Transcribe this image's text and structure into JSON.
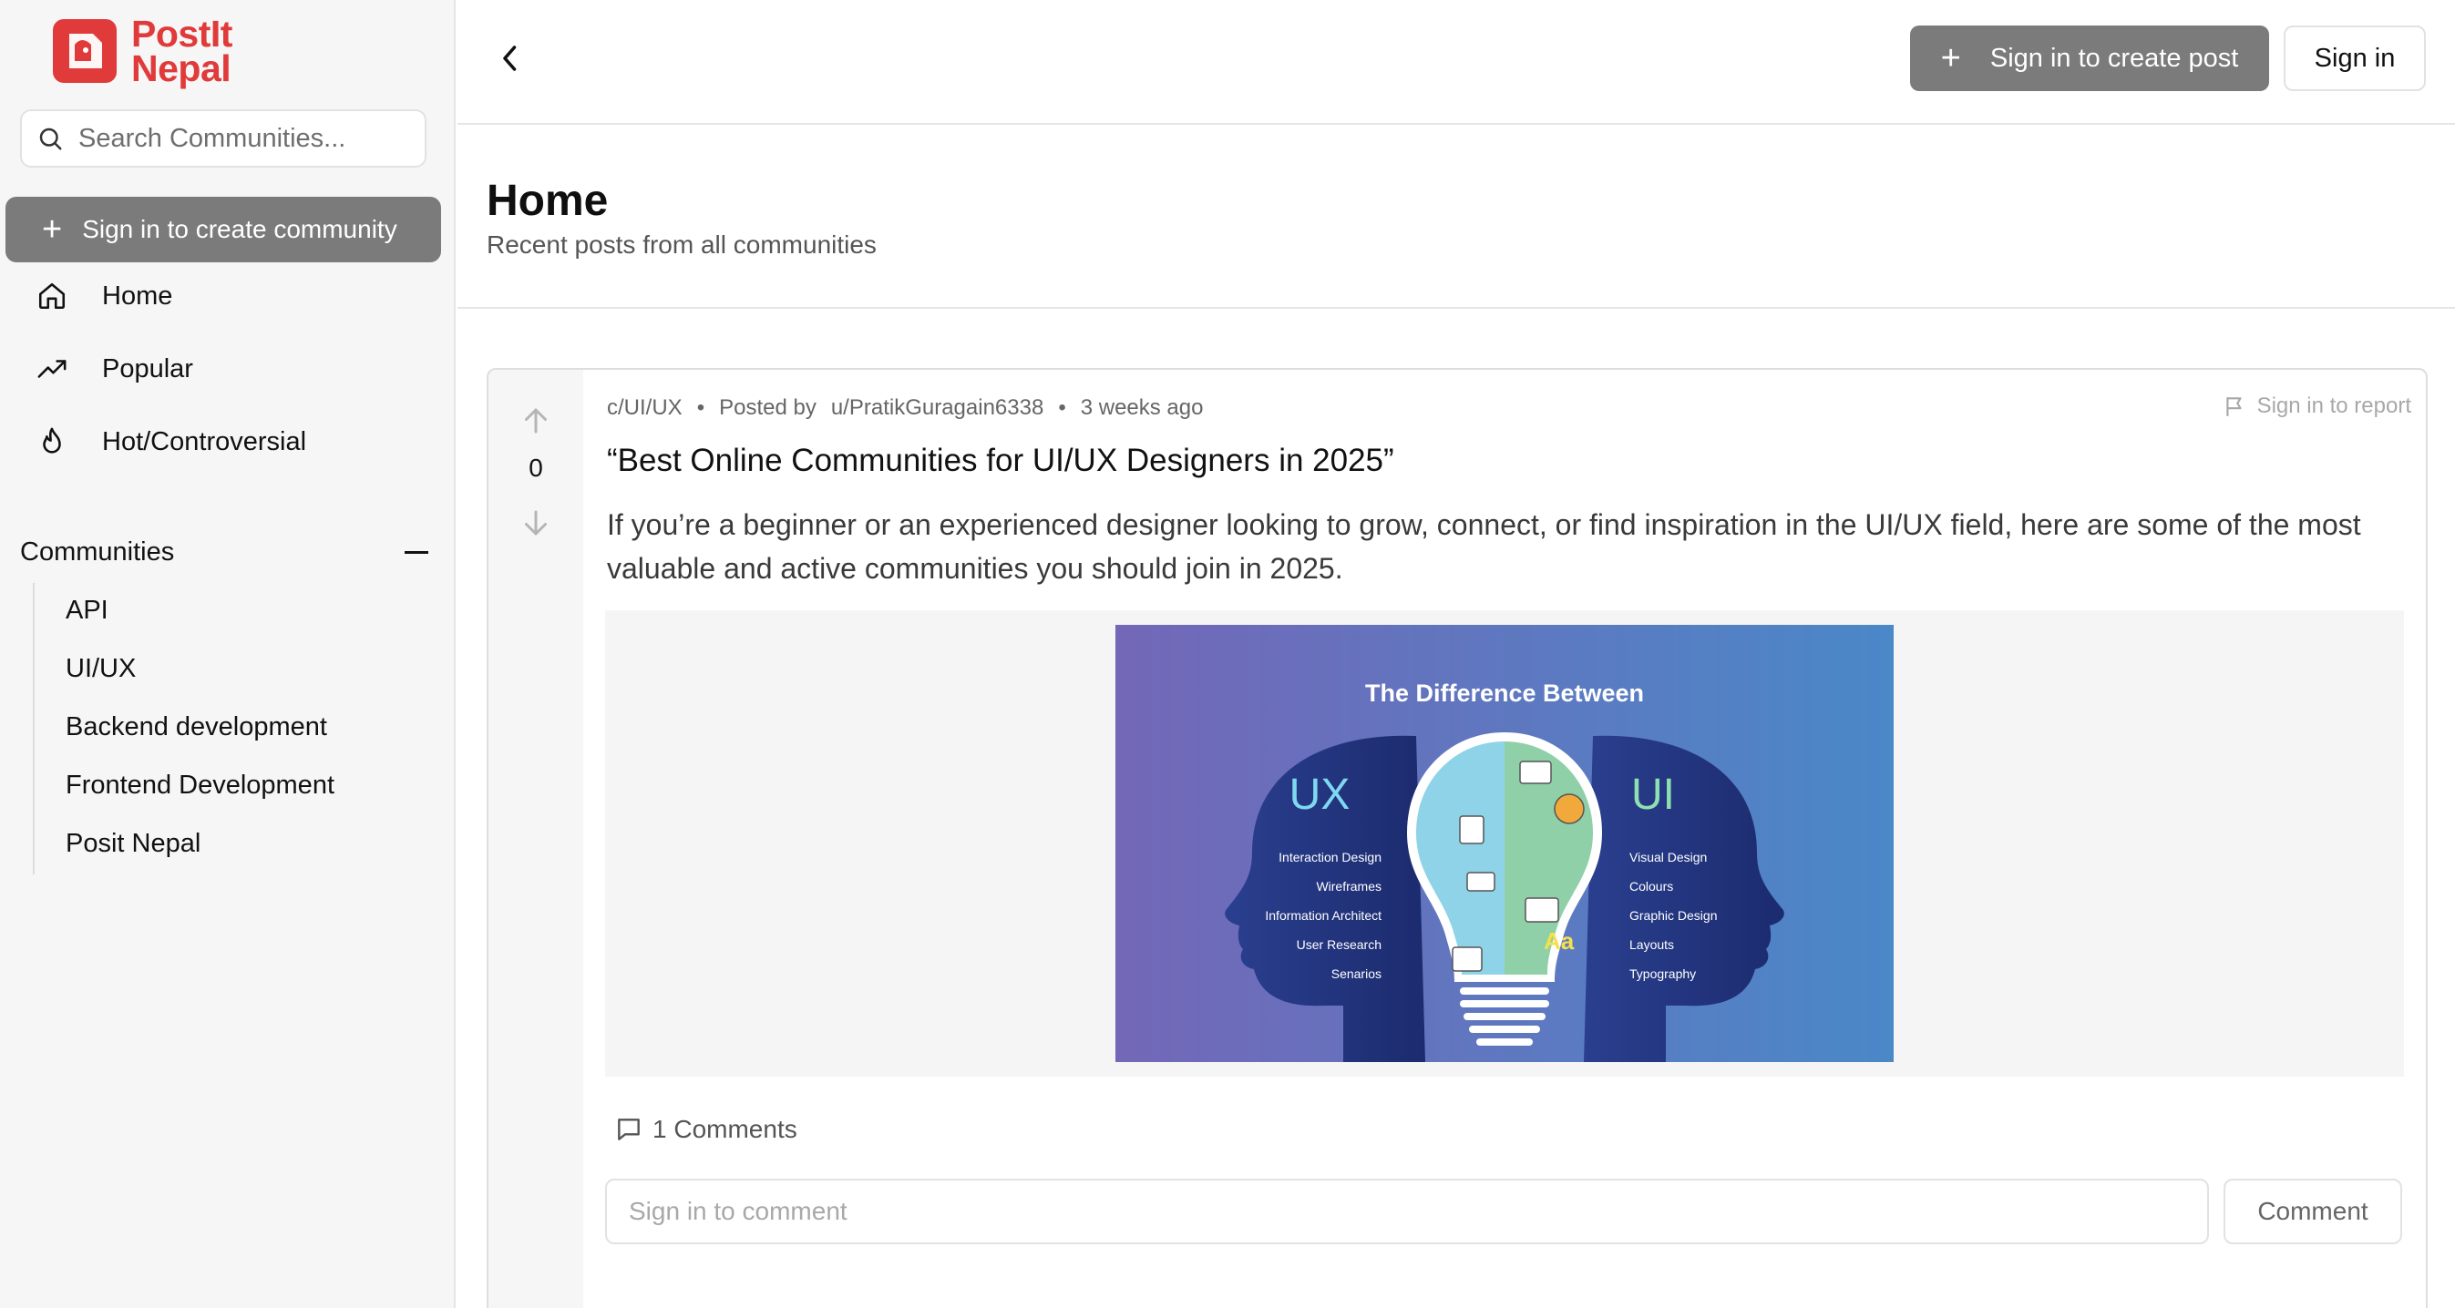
{
  "brand": {
    "line1": "PostIt",
    "line2": "Nepal",
    "color": "#e03a3a"
  },
  "sidebar": {
    "search_placeholder": "Search Communities...",
    "create_community_label": "Sign in to create community",
    "nav": [
      {
        "label": "Home",
        "icon": "home-icon"
      },
      {
        "label": "Popular",
        "icon": "trending-up-icon"
      },
      {
        "label": "Hot/Controversial",
        "icon": "flame-icon"
      }
    ],
    "communities_title": "Communities",
    "communities": [
      "API",
      "UI/UX",
      "Backend development",
      "Frontend Development",
      "Posit Nepal"
    ]
  },
  "topbar": {
    "create_post_label": "Sign in to create post",
    "signin_label": "Sign in"
  },
  "page": {
    "title": "Home",
    "subtitle": "Recent posts from all communities"
  },
  "post": {
    "score": "0",
    "community": "c/UI/UX",
    "posted_by_label": "Posted by",
    "author": "u/PratikGuragain6338",
    "time": "3 weeks ago",
    "report_label": "Sign in to report",
    "title": "“Best Online Communities for UI/UX Designers in 2025”",
    "body": "If you’re a beginner or an experienced designer looking to grow, connect, or find inspiration in the UI/UX field, here are some of the most valuable and active communities you should join in 2025.",
    "image": {
      "heading": "The Difference Between",
      "left_title": "UX",
      "left_items": [
        "Interaction Design",
        "Wireframes",
        "Information Architect",
        "User Research",
        "Senarios"
      ],
      "right_title": "UI",
      "right_items": [
        "Visual Design",
        "Colours",
        "Graphic Design",
        "Layouts",
        "Typography"
      ]
    },
    "comments_label": "1 Comments",
    "comment_placeholder": "Sign in to comment",
    "comment_button": "Comment"
  },
  "colors": {
    "disabled_button": "#7b7b7b",
    "sidebar_bg": "#f6f6f6",
    "image_gradient_start": "#7367b8",
    "image_gradient_end": "#4a88c8"
  }
}
